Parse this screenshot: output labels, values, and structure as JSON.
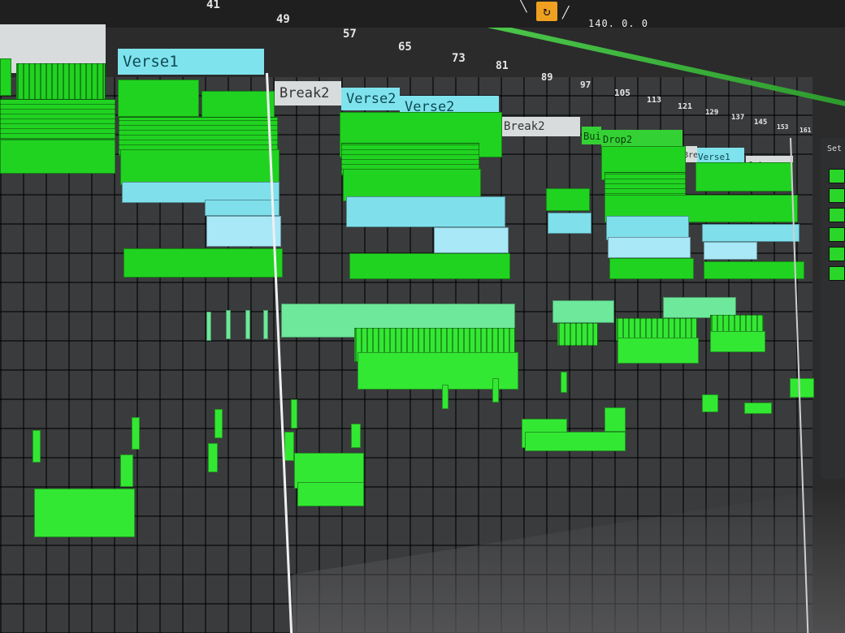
{
  "ruler": {
    "bars_top": [
      "41",
      "49",
      "57",
      "65",
      "73",
      "81",
      "89",
      "97",
      "105",
      "113",
      "121",
      "129",
      "137",
      "145",
      "153",
      "161"
    ]
  },
  "transport": {
    "tempo": "140. 0. 0",
    "loop_icon": "loop-icon",
    "draw_icon": "draw-mode-icon",
    "curve_icon": "curve-icon"
  },
  "locators": {
    "verse1_a": "Verse1",
    "break2_a": "Break2",
    "verse2_a": "Verse2",
    "verse2_b": "Verse2",
    "break2_b": "Break2",
    "build": "Buil",
    "drop2": "Drop2",
    "break_short": "Bre",
    "verse1_b": "Verse1",
    "outro": "Outro"
  },
  "side_panel": {
    "label": "Set"
  },
  "colors": {
    "clip_green": "#21d321",
    "clip_cyan": "#7fe0ec",
    "loop_accent": "#f0a020",
    "background": "#3a3b3d"
  }
}
